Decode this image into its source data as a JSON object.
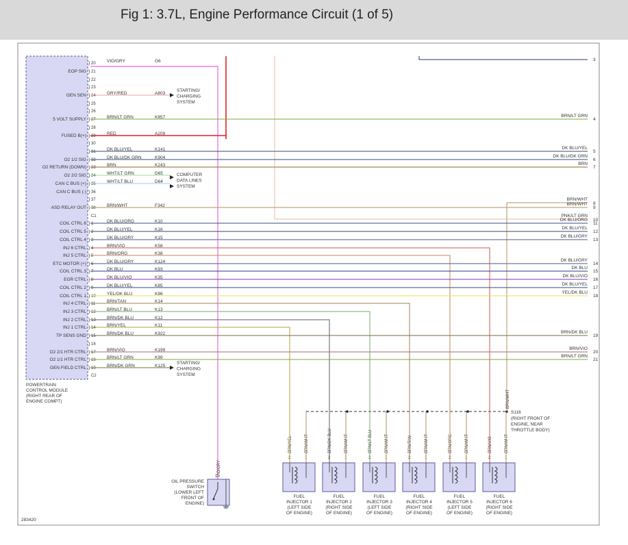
{
  "title": "Fig 1: 3.7L, Engine Performance Circuit (1 of 5)",
  "diagram_id": "283420",
  "pcm": {
    "label": [
      "POWERTRAIN",
      "CONTROL MODULE",
      "(RIGHT REAR OF",
      "ENGINE COMPT)"
    ],
    "connector_labels": [
      "C1",
      "C2"
    ]
  },
  "pins": [
    {
      "func": "",
      "pin": "20",
      "color": "VIO/GRY",
      "circuit": "G6",
      "wire": "#ee66dd",
      "end": "oilsw"
    },
    {
      "func": "EOP SIG",
      "pin": "21",
      "color": "",
      "circuit": "",
      "wire": "",
      "end": ""
    },
    {
      "func": "",
      "pin": "22",
      "color": "",
      "circuit": "",
      "wire": "",
      "end": ""
    },
    {
      "func": "",
      "pin": "23",
      "color": "",
      "circuit": "",
      "wire": "",
      "end": ""
    },
    {
      "func": "GEN SEN",
      "pin": "24",
      "color": "GRY/RED",
      "circuit": "A803",
      "wire": "#e8a0a0",
      "end": "arrow"
    },
    {
      "func": "",
      "pin": "25",
      "color": "",
      "circuit": "",
      "wire": "",
      "end": ""
    },
    {
      "func": "",
      "pin": "26",
      "color": "",
      "circuit": "",
      "wire": "",
      "end": ""
    },
    {
      "func": "5 VOLT SUPPLY",
      "pin": "27",
      "color": "BRN/LT GRN",
      "circuit": "K857",
      "wire": "#7aa83a",
      "end": "right",
      "rlabel": "BRN/LT GRN",
      "rnum": "4"
    },
    {
      "func": "",
      "pin": "28",
      "color": "",
      "circuit": "",
      "wire": "",
      "end": ""
    },
    {
      "func": "FUSED B(+)",
      "pin": "29",
      "color": "RED",
      "circuit": "A209",
      "wire": "#dd2222",
      "end": "up"
    },
    {
      "func": "",
      "pin": "30",
      "color": "",
      "circuit": "",
      "wire": "",
      "end": ""
    },
    {
      "func": "",
      "pin": "31",
      "color": "DK BLU/YEL",
      "circuit": "K141",
      "wire": "#334a7a",
      "end": "right",
      "rlabel": "DK BLU/YEL",
      "rnum": "5"
    },
    {
      "func": "O2 1/2 SIG",
      "pin": "32",
      "color": "DK BLU/DK GRN",
      "circuit": "K904",
      "wire": "#2f4f6f",
      "end": "right",
      "rlabel": "DK BLU/DK GRN",
      "rnum": "6"
    },
    {
      "func": "O2 RETURN (DOWN)",
      "pin": "33",
      "color": "BRN",
      "circuit": "K243",
      "wire": "#8a6a2a",
      "end": "right",
      "rlabel": "BRN",
      "rnum": "7"
    },
    {
      "func": "O2 2/2 SIG",
      "pin": "34",
      "color": "WHT/LT GRN",
      "circuit": "D65",
      "wire": "#99dd99",
      "end": "arrow2"
    },
    {
      "func": "CAN C BUS (+)",
      "pin": "35",
      "color": "WHT/LT BLU",
      "circuit": "D64",
      "wire": "#99ccee",
      "end": "arrow3"
    },
    {
      "func": "CAN C BUS (-)",
      "pin": "36",
      "color": "",
      "circuit": "",
      "wire": "",
      "end": ""
    },
    {
      "func": "",
      "pin": "37",
      "color": "",
      "circuit": "",
      "wire": "",
      "end": ""
    },
    {
      "func": "ASD RELAY OUT",
      "pin": "38",
      "color": "BRN/WHT",
      "circuit": "F342",
      "wire": "#b09060",
      "end": "right",
      "rlabel": "BRN/WHT",
      "rnum": "9"
    },
    {
      "func": "",
      "pin": "C1",
      "color": "",
      "circuit": "",
      "wire": "",
      "end": ""
    },
    {
      "func": "COIL CTRL 6",
      "pin": "1",
      "color": "DK BLU/ORG",
      "circuit": "K10",
      "wire": "#3a4a8a",
      "end": "right",
      "rlabel": "DK BLU/ORG",
      "rnum": "11"
    },
    {
      "func": "COIL CTRL 5",
      "pin": "2",
      "color": "DK BLU/YEL",
      "circuit": "K16",
      "wire": "#334a7a",
      "end": "right",
      "rlabel": "DK BLU/YEL",
      "rnum": "12"
    },
    {
      "func": "COIL CTRL 4",
      "pin": "3",
      "color": "DK BLU/GRY",
      "circuit": "K15",
      "wire": "#4a5a8a",
      "end": "right",
      "rlabel": "DK BLU/GRY",
      "rnum": "13"
    },
    {
      "func": "INJ 6 CTRL",
      "pin": "4",
      "color": "BRN/VIO",
      "circuit": "K58",
      "wire": "#cc5555",
      "end": "inj",
      "inj": 5
    },
    {
      "func": "INJ 5 CTRL",
      "pin": "5",
      "color": "BRN/ORG",
      "circuit": "K38",
      "wire": "#c08a50",
      "end": "inj",
      "inj": 4
    },
    {
      "func": "ETC MOTOR (+)",
      "pin": "6",
      "color": "DK BLU/GRY",
      "circuit": "K124",
      "wire": "#4a5a8a",
      "end": "right",
      "rlabel": "DK BLU/GRY",
      "rnum": "14"
    },
    {
      "func": "COIL CTRL 3",
      "pin": "7",
      "color": "DK BLU",
      "circuit": "K93",
      "wire": "#2a3a8a",
      "end": "right",
      "rlabel": "DK BLU",
      "rnum": "15"
    },
    {
      "func": "EGR CTRL",
      "pin": "8",
      "color": "DK BLU/VIO",
      "circuit": "K35",
      "wire": "#7a3aaa",
      "end": "right",
      "rlabel": "DK BLU/VIO",
      "rnum": "16"
    },
    {
      "func": "COIL CTRL 2",
      "pin": "9",
      "color": "DK BLU/YEL",
      "circuit": "K85",
      "wire": "#334a7a",
      "end": "right",
      "rlabel": "DK BLU/YEL",
      "rnum": "17"
    },
    {
      "func": "COIL CTRL 1",
      "pin": "10",
      "color": "YEL/DK BLU",
      "circuit": "K86",
      "wire": "#e8e050",
      "end": "right",
      "rlabel": "YEL/DK BLU",
      "rnum": "18"
    },
    {
      "func": "INJ 4 CTRL",
      "pin": "11",
      "color": "BRN/TAN",
      "circuit": "K14",
      "wire": "#a08050",
      "end": "inj",
      "inj": 3
    },
    {
      "func": "INJ 3 CTRL",
      "pin": "12",
      "color": "BRN/LT BLU",
      "circuit": "K13",
      "wire": "#7aaa6a",
      "end": "inj",
      "inj": 2
    },
    {
      "func": "INJ 2 CTRL",
      "pin": "13",
      "color": "BRN/DK BLU",
      "circuit": "K12",
      "wire": "#5a5a6a",
      "end": "inj",
      "inj": 1
    },
    {
      "func": "INJ 1 CTRL",
      "pin": "14",
      "color": "BRN/YEL",
      "circuit": "K11",
      "wire": "#b0a040",
      "end": "inj",
      "inj": 0
    },
    {
      "func": "TP SENS GND",
      "pin": "15",
      "color": "BRN/DK BLU",
      "circuit": "K922",
      "wire": "#7a6a4a",
      "end": "right",
      "rlabel": "BRN/DK BLU",
      "rnum": "19"
    },
    {
      "func": "",
      "pin": "16",
      "color": "",
      "circuit": "",
      "wire": "",
      "end": ""
    },
    {
      "func": "O2 2/1 HTR CTRL",
      "pin": "17",
      "color": "BRN/VIO",
      "circuit": "K199",
      "wire": "#a06a6a",
      "end": "right",
      "rlabel": "BRN/VIO",
      "rnum": "20"
    },
    {
      "func": "O2 1/1 HTR CTRL",
      "pin": "18",
      "color": "BRN/LT GRN",
      "circuit": "K99",
      "wire": "#7aa83a",
      "end": "right",
      "rlabel": "BRN/LT GRN",
      "rnum": "21"
    },
    {
      "func": "GEN FIELD CTRL",
      "pin": "19",
      "color": "BRN/DK GRN",
      "circuit": "K125",
      "wire": "#6a7a3a",
      "end": "arrow4"
    },
    {
      "func": "",
      "pin": "C2",
      "color": "",
      "circuit": "",
      "wire": "",
      "end": ""
    }
  ],
  "top_right": [
    {
      "label": "",
      "num": "3"
    },
    {
      "label": "BRN/WHT",
      "num": "8"
    },
    {
      "label": "PNK/LT GRN",
      "num": "10"
    }
  ],
  "destinations": {
    "starting_charging": [
      "STARTING/",
      "CHARGING",
      "SYSTEM"
    ],
    "computer_data": [
      "COMPUTER",
      "DATA LINES",
      "SYSTEM"
    ]
  },
  "splice": {
    "name": "S116",
    "desc": [
      "(RIGHT FRONT OF",
      "ENGINE, NEAR",
      "THROTTLE BODY)"
    ],
    "wire_label": "BRN/WHT"
  },
  "oil_switch": {
    "label": [
      "OIL PRESSURE",
      "SWITCH",
      "(LOWER LEFT",
      "FRONT OF",
      "ENGINE)"
    ],
    "wire_label": "VIO/GRY",
    "pin": "1"
  },
  "injectors": [
    {
      "name": [
        "FUEL",
        "INJECTOR 1",
        "(LEFT SIDE",
        "OF ENGINE)"
      ],
      "ctrl": "BRN/YEL",
      "pwr": "BRN/WHT"
    },
    {
      "name": [
        "FUEL",
        "INJECTOR 2",
        "(RIGHT SIDE",
        "OF ENGINE)"
      ],
      "ctrl": "BRN/DK BLU",
      "pwr": "BRN/WHT"
    },
    {
      "name": [
        "FUEL",
        "INJECTOR 3",
        "(LEFT SIDE",
        "OF ENGINE)"
      ],
      "ctrl": "BRN/LT BLU",
      "pwr": "BRN/WHT"
    },
    {
      "name": [
        "FUEL",
        "INJECTOR 4",
        "(RIGHT SIDE",
        "OF ENGINE)"
      ],
      "ctrl": "BRN/TAN",
      "pwr": "BRN/WHT"
    },
    {
      "name": [
        "FUEL",
        "INJECTOR 5",
        "(LEFT SIDE",
        "OF ENGINE)"
      ],
      "ctrl": "BRN/ORG",
      "pwr": "BRN/WHT"
    },
    {
      "name": [
        "FUEL",
        "INJECTOR 6",
        "(RIGHT SIDE",
        "OF ENGINE)"
      ],
      "ctrl": "BRN/VIO",
      "pwr": "BRN/WHT"
    }
  ],
  "injector_pins": [
    "2",
    "1"
  ]
}
